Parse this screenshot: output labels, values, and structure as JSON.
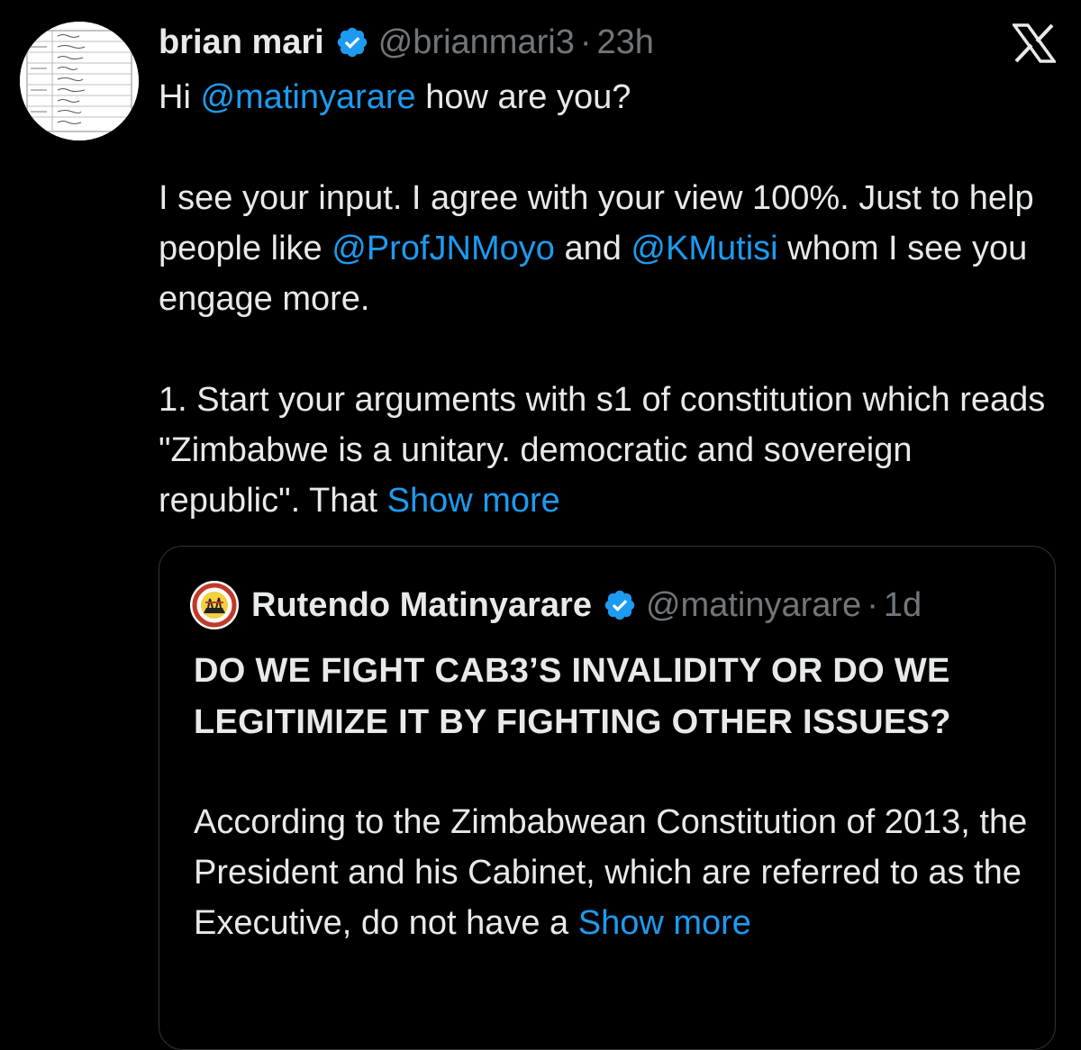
{
  "tweet": {
    "author_name": "brian mari",
    "author_handle": "@brianmari3",
    "separator": "·",
    "time": "23h",
    "avatar_icon": "document-avatar-icon",
    "verified_icon": "verified-badge-icon",
    "line1_pre": "Hi ",
    "line1_mention": "@matinyarare",
    "line1_post": " how are you?",
    "para2_pre": "I see your input. I agree with your view 100%. Just to help people like ",
    "para2_mention1": "@ProfJNMoyo",
    "para2_mid": " and ",
    "para2_mention2": "@KMutisi",
    "para2_post": " whom I see you engage more.",
    "para3_text": "1. Start your arguments with s1 of constitution which reads \"Zimbabwe is a unitary. democratic and sovereign republic\". That ",
    "show_more": "Show more"
  },
  "logo": {
    "icon": "x-logo-icon"
  },
  "quote": {
    "author_name": "Rutendo Matinyarare",
    "author_handle": "@matinyarare",
    "separator": "·",
    "time": "1d",
    "avatar_icon": "movement-logo-avatar-icon",
    "avatar_text": "ZIMBABWE ANTI-SANCTIONS MOVEMENT",
    "headline": "DO WE FIGHT CAB3’S INVALIDITY OR DO WE LEGITIMIZE IT BY FIGHTING OTHER ISSUES?",
    "body": "According to the Zimbabwean Constitution of 2013, the President and his Cabinet, which are referred to as the Executive, do not have a ",
    "show_more": "Show more"
  },
  "colors": {
    "background": "#000000",
    "text": "#e7e9ea",
    "muted": "#71767b",
    "link": "#1d9bf0",
    "border": "#2f3336",
    "verified": "#1d9bf0"
  }
}
